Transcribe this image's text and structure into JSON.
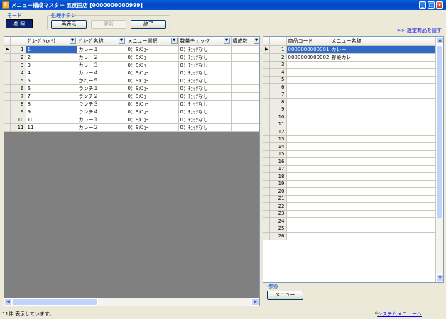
{
  "window": {
    "title": "メニュー構成マスター  五反田店 [0000000000999]",
    "controls": [
      "_",
      "□",
      "x"
    ]
  },
  "mode": {
    "label": "モード",
    "value": "参 照"
  },
  "process": {
    "label": "処理ボタン",
    "buttons": {
      "refresh": "再表示",
      "update": "更新",
      "exit": "終了"
    }
  },
  "link": {
    "hide_set_items": ">> 設定商品を隠す"
  },
  "left_grid": {
    "columns": [
      "ｸﾞﾙｰﾌﾟNo(*)",
      "ｸﾞﾙｰﾌﾟ名称",
      "メニュー選択",
      "数量チェック",
      "構成数"
    ],
    "rows": [
      {
        "n": "1",
        "no": "1",
        "name": "カレー１",
        "sel": "0：Sﾒﾆｭｰ",
        "chk": "0：ﾁｪｯｸなし"
      },
      {
        "n": "2",
        "no": "2",
        "name": "カレー２",
        "sel": "0：Sﾒﾆｭｰ",
        "chk": "0：ﾁｪｯｸなし"
      },
      {
        "n": "3",
        "no": "3",
        "name": "カレー３",
        "sel": "0：Sﾒﾆｭｰ",
        "chk": "0：ﾁｪｯｸなし"
      },
      {
        "n": "4",
        "no": "4",
        "name": "カレー４",
        "sel": "0：Sﾒﾆｭｰ",
        "chk": "0：ﾁｪｯｸなし"
      },
      {
        "n": "5",
        "no": "5",
        "name": "かれー５",
        "sel": "0：Sﾒﾆｭｰ",
        "chk": "0：ﾁｪｯｸなし"
      },
      {
        "n": "6",
        "no": "6",
        "name": "ランチ１",
        "sel": "0：Sﾒﾆｭｰ",
        "chk": "0：ﾁｪｯｸなし"
      },
      {
        "n": "7",
        "no": "7",
        "name": "ランチ２",
        "sel": "0：Sﾒﾆｭｰ",
        "chk": "0：ﾁｪｯｸなし"
      },
      {
        "n": "8",
        "no": "8",
        "name": "ランチ３",
        "sel": "0：Sﾒﾆｭｰ",
        "chk": "0：ﾁｪｯｸなし"
      },
      {
        "n": "9",
        "no": "9",
        "name": "ランチ４",
        "sel": "0：Sﾒﾆｭｰ",
        "chk": "0：ﾁｪｯｸなし"
      },
      {
        "n": "10",
        "no": "10",
        "name": "カレー１",
        "sel": "0：Sﾒﾆｭｰ",
        "chk": "0：ﾁｪｯｸなし"
      },
      {
        "n": "11",
        "no": "11",
        "name": "カレー２",
        "sel": "0：Sﾒﾆｭｰ",
        "chk": "0：ﾁｪｯｸなし"
      }
    ]
  },
  "right_grid": {
    "columns": [
      "商品コード",
      "メニュー名称"
    ],
    "rows": [
      {
        "n": "1",
        "code": "0000000000001",
        "name": "カレー"
      },
      {
        "n": "2",
        "code": "0000000000002",
        "name": "野菜カレー"
      },
      {
        "n": "3",
        "code": "",
        "name": ""
      },
      {
        "n": "4",
        "code": "",
        "name": ""
      },
      {
        "n": "5",
        "code": "",
        "name": ""
      },
      {
        "n": "6",
        "code": "",
        "name": ""
      },
      {
        "n": "7",
        "code": "",
        "name": ""
      },
      {
        "n": "8",
        "code": "",
        "name": ""
      },
      {
        "n": "9",
        "code": "",
        "name": ""
      },
      {
        "n": "10",
        "code": "",
        "name": ""
      },
      {
        "n": "11",
        "code": "",
        "name": ""
      },
      {
        "n": "12",
        "code": "",
        "name": ""
      },
      {
        "n": "13",
        "code": "",
        "name": ""
      },
      {
        "n": "14",
        "code": "",
        "name": ""
      },
      {
        "n": "15",
        "code": "",
        "name": ""
      },
      {
        "n": "16",
        "code": "",
        "name": ""
      },
      {
        "n": "17",
        "code": "",
        "name": ""
      },
      {
        "n": "18",
        "code": "",
        "name": ""
      },
      {
        "n": "19",
        "code": "",
        "name": ""
      },
      {
        "n": "20",
        "code": "",
        "name": ""
      },
      {
        "n": "21",
        "code": "",
        "name": ""
      },
      {
        "n": "22",
        "code": "",
        "name": ""
      },
      {
        "n": "23",
        "code": "",
        "name": ""
      },
      {
        "n": "24",
        "code": "",
        "name": ""
      },
      {
        "n": "25",
        "code": "",
        "name": ""
      },
      {
        "n": "26",
        "code": "",
        "name": ""
      }
    ]
  },
  "ref_panel": {
    "label": "参照",
    "button": "メニュー"
  },
  "status": {
    "message": "11件 表示しています。",
    "system_menu": "システムメニューへ"
  },
  "colors": {
    "selection": "#316ac5",
    "accent": "#0046d5",
    "titlebar": "#0049c9"
  }
}
